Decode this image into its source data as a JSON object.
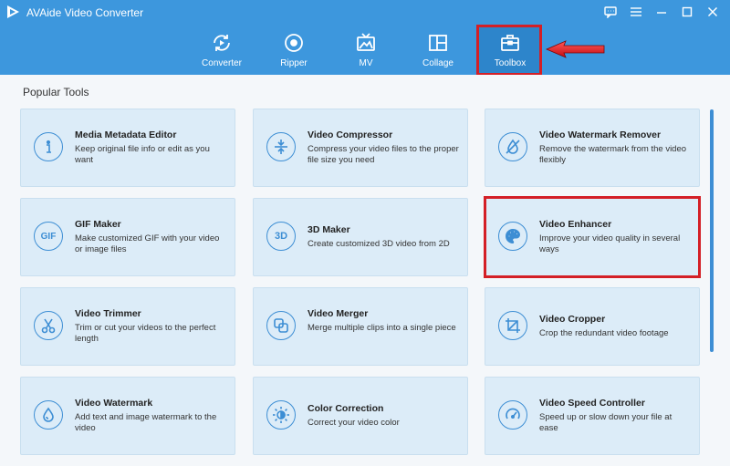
{
  "app": {
    "title": "AVAide Video Converter",
    "logo_icon": "play-logo-icon",
    "accent_color": "#3d97dd",
    "highlight_color": "#d41f26"
  },
  "window_controls": [
    {
      "name": "feedback-icon"
    },
    {
      "name": "menu-icon"
    },
    {
      "name": "minimize-icon"
    },
    {
      "name": "maximize-icon"
    },
    {
      "name": "close-icon"
    }
  ],
  "nav": {
    "items": [
      {
        "label": "Converter",
        "icon": "converter-icon"
      },
      {
        "label": "Ripper",
        "icon": "ripper-icon"
      },
      {
        "label": "MV",
        "icon": "mv-icon"
      },
      {
        "label": "Collage",
        "icon": "collage-icon"
      },
      {
        "label": "Toolbox",
        "icon": "toolbox-icon",
        "active": true
      }
    ]
  },
  "section": {
    "title": "Popular Tools"
  },
  "tools": [
    {
      "title": "Media Metadata Editor",
      "desc": "Keep original file info or edit as you want",
      "icon": "info-icon"
    },
    {
      "title": "Video Compressor",
      "desc": "Compress your video files to the proper file size you need",
      "icon": "compress-icon"
    },
    {
      "title": "Video Watermark Remover",
      "desc": "Remove the watermark from the video flexibly",
      "icon": "watermark-remove-icon"
    },
    {
      "title": "GIF Maker",
      "desc": "Make customized GIF with your video or image files",
      "icon": "gif-icon",
      "icon_text": "GIF"
    },
    {
      "title": "3D Maker",
      "desc": "Create customized 3D video from 2D",
      "icon": "3d-icon",
      "icon_text": "3D"
    },
    {
      "title": "Video Enhancer",
      "desc": "Improve your video quality in several ways",
      "icon": "palette-icon",
      "highlighted": true
    },
    {
      "title": "Video Trimmer",
      "desc": "Trim or cut your videos to the perfect length",
      "icon": "scissors-icon"
    },
    {
      "title": "Video Merger",
      "desc": "Merge multiple clips into a single piece",
      "icon": "merge-icon"
    },
    {
      "title": "Video Cropper",
      "desc": "Crop the redundant video footage",
      "icon": "crop-icon"
    },
    {
      "title": "Video Watermark",
      "desc": "Add text and image watermark to the video",
      "icon": "drop-icon"
    },
    {
      "title": "Color Correction",
      "desc": "Correct your video color",
      "icon": "sun-icon"
    },
    {
      "title": "Video Speed Controller",
      "desc": "Speed up or slow down your file at ease",
      "icon": "speedometer-icon"
    }
  ]
}
